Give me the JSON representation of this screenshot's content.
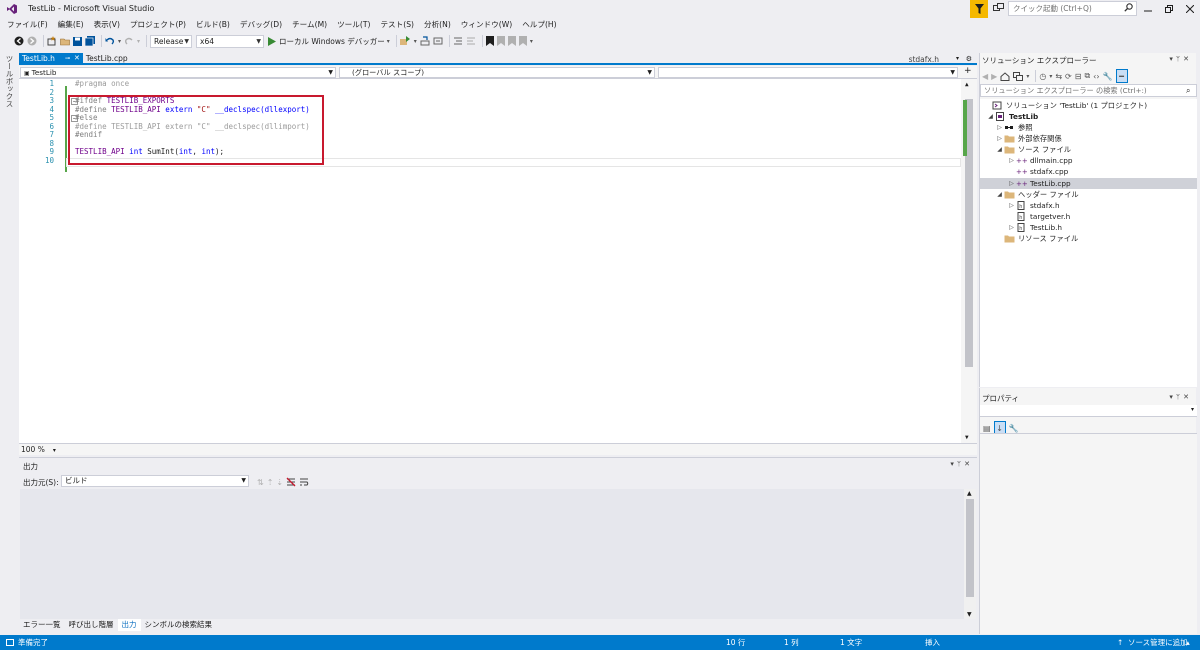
{
  "window": {
    "title": "TestLib - Microsoft Visual Studio"
  },
  "quick_launch": {
    "placeholder": "クイック起動 (Ctrl+Q)"
  },
  "menu": [
    "ファイル(F)",
    "編集(E)",
    "表示(V)",
    "プロジェクト(P)",
    "ビルド(B)",
    "デバッグ(D)",
    "チーム(M)",
    "ツール(T)",
    "テスト(S)",
    "分析(N)",
    "ウィンドウ(W)",
    "ヘルプ(H)"
  ],
  "toolbar": {
    "config": "Release",
    "platform": "x64",
    "debugger": "ローカル Windows デバッガー"
  },
  "toolbox_label": "ツールボックス",
  "editor": {
    "tabs": [
      {
        "label": "TestLib.h",
        "active": true
      },
      {
        "label": "TestLib.cpp",
        "active": false
      }
    ],
    "preview_tab": "stdafx.h",
    "nav_project": "TestLib",
    "nav_scope": "(グローバル スコープ)",
    "nav_member": "",
    "line_numbers": [
      "1",
      "2",
      "3",
      "4",
      "5",
      "6",
      "7",
      "8",
      "9",
      "10"
    ],
    "lines": {
      "l1": "#pragma once",
      "l3a": "#ifdef ",
      "l3b": "TESTLIB_EXPORTS",
      "l4a": "#define ",
      "l4b": "TESTLIB_API",
      "l4c": " extern ",
      "l4d": "\"C\"",
      "l4e": " __declspec(dllexport)",
      "l5": "#else",
      "l6": "#define TESTLIB_API extern \"C\" __declspec(dllimport)",
      "l7": "#endif",
      "l9a": "TESTLIB_API",
      "l9b": " int ",
      "l9c": "SumInt(",
      "l9d": "int",
      "l9e": ", ",
      "l9f": "int",
      "l9g": ");"
    },
    "zoom": "100 %"
  },
  "output": {
    "title": "出力",
    "source_label": "出力元(S):",
    "source_value": "ビルド"
  },
  "bottom_tabs": [
    "エラー一覧",
    "呼び出し階層",
    "出力",
    "シンボルの検索結果"
  ],
  "bottom_tab_active": "出力",
  "statusbar": {
    "ready": "準備完了",
    "line": "10 行",
    "col": "1 列",
    "char": "1 文字",
    "mode": "挿入",
    "source_control": "ソース管理に追加"
  },
  "solution_explorer": {
    "title": "ソリューション エクスプローラー",
    "search_placeholder": "ソリューション エクスプローラー の検索 (Ctrl+:)",
    "solution": "ソリューション 'TestLib' (1 プロジェクト)",
    "project": "TestLib",
    "references": "参照",
    "external_deps": "外部依存関係",
    "source_files": "ソース ファイル",
    "dllmain": "dllmain.cpp",
    "stdafx_cpp": "stdafx.cpp",
    "testlib_cpp": "TestLib.cpp",
    "header_files": "ヘッダー ファイル",
    "stdafx_h": "stdafx.h",
    "targetver_h": "targetver.h",
    "testlib_h": "TestLib.h",
    "resource_files": "リソース ファイル"
  },
  "properties": {
    "title": "プロパティ"
  },
  "colors": {
    "accent": "#007acc",
    "highlight_box": "#c8192e",
    "notification": "#f5b800",
    "line_number": "#2b91af",
    "keyword": "#0000ff",
    "macro": "#6f008a",
    "string": "#a31515"
  }
}
